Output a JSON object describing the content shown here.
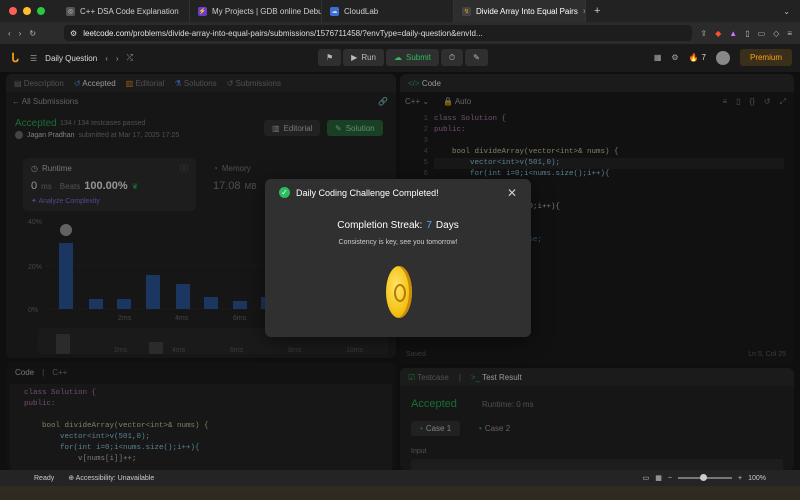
{
  "browser": {
    "tabs": [
      {
        "label": "C++ DSA Code Explanation",
        "active": false
      },
      {
        "label": "My Projects | GDB online Debugg",
        "active": false
      },
      {
        "label": "CloudLab",
        "active": false
      },
      {
        "label": "Divide Array Into Equal Pairs",
        "active": true
      }
    ],
    "url_host": "leetcode.com",
    "url_path": "/problems/divide-array-into-equal-pairs/submissions/1576711458/?envType=daily-question&envId..."
  },
  "lcnav": {
    "section": "Daily Question",
    "run": "Run",
    "submit": "Submit",
    "streak_count": "7",
    "premium": "Premium"
  },
  "left": {
    "tabs": [
      "Description",
      "Accepted",
      "Editorial",
      "Solutions",
      "Submissions"
    ],
    "back_link": "All Submissions",
    "status": "Accepted",
    "testcases": "134 / 134 testcases passed",
    "author": "Jagan Pradhan",
    "submitted": "submitted at Mar 17, 2025 17:25",
    "editorial_btn": "Editorial",
    "solution_btn": "Solution",
    "runtime_label": "Runtime",
    "runtime_value": "0",
    "runtime_unit": "ms",
    "beats_label": "Beats",
    "beats_value": "100.00%",
    "analyze": "Analyze Complexity",
    "memory_label": "Memory",
    "memory_value": "17.08",
    "memory_unit": "MB",
    "chart_y": [
      "40%",
      "20%",
      "0%"
    ],
    "chart_x": [
      "2ms",
      "4ms",
      "6ms"
    ],
    "mini_x": [
      "2ms",
      "4ms",
      "6ms",
      "8ms",
      "10ms"
    ],
    "code_header": "Code",
    "code_lang": "C++",
    "code_lines": [
      "class Solution {",
      "public:",
      "",
      "    bool divideArray(vector<int>& nums) {",
      "        vector<int>v(501,0);",
      "        for(int i=0;i<nums.size();i++){",
      "            v[nums[i]]++;"
    ]
  },
  "right": {
    "title": "Code",
    "lang": "C++",
    "auto": "Auto",
    "line_numbers": [
      "1",
      "2",
      "3",
      "4",
      "5",
      "6",
      "7",
      "8",
      "9",
      "10",
      "11",
      "12",
      "13",
      "14"
    ],
    "code_lines": [
      "class Solution {",
      "public:",
      "",
      "    bool divideArray(vector<int>& nums) {",
      "        vector<int>v(501,0);",
      "        for(int i=0;i<nums.size();i++){",
      "                  ++;",
      "",
      "                  =500;i++){",
      "                  %2;",
      "",
      "                  false;",
      "",
      ""
    ],
    "saved": "Saved",
    "cursor": "Ln 5, Col 25",
    "test_tab": "Testcase",
    "result_tab": "Test Result",
    "result_status": "Accepted",
    "result_runtime": "Runtime: 0 ms",
    "case1": "Case 1",
    "case2": "Case 2",
    "input_label": "Input"
  },
  "modal": {
    "title": "Daily Coding Challenge Completed!",
    "streak_label": "Completion Streak:",
    "streak_value": "7",
    "streak_unit": "Days",
    "message": "Consistency is key, see you tomorrow!"
  },
  "statusbar": {
    "ready": "Ready",
    "accessibility": "Accessibility: Unavailable",
    "zoom": "100%"
  },
  "colors": {
    "accent_green": "#2cbb5d",
    "accent_orange": "#ffa116",
    "streak_blue": "#5aa0ff"
  }
}
